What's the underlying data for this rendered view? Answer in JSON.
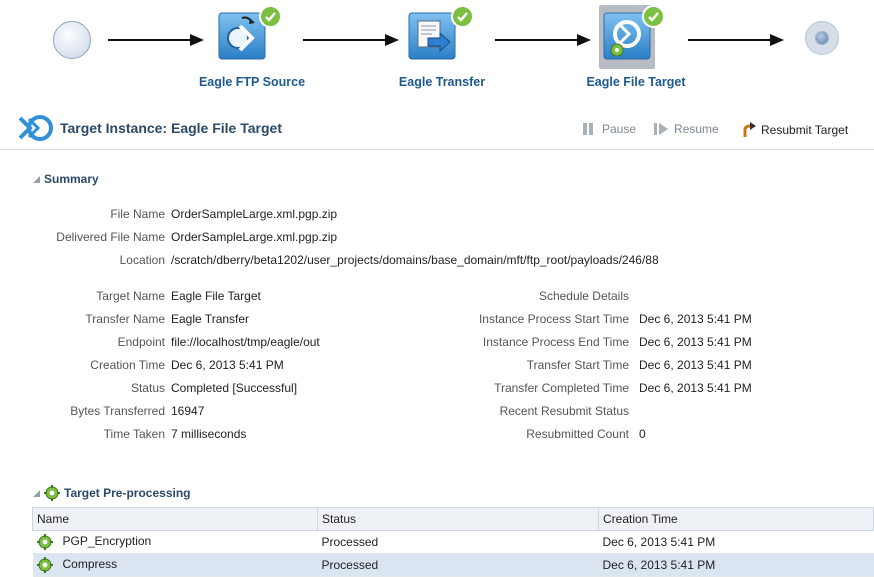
{
  "flow": {
    "nodes": [
      {
        "label": "Eagle FTP Source",
        "icon": "ftp-source-icon",
        "status": "completed"
      },
      {
        "label": "Eagle Transfer",
        "icon": "transfer-icon",
        "status": "completed"
      },
      {
        "label": "Eagle File Target",
        "icon": "file-target-icon",
        "status": "completed",
        "selected": true
      }
    ]
  },
  "header": {
    "title": "Target Instance: Eagle File Target",
    "actions": [
      {
        "label": "Pause",
        "icon": "pause-icon",
        "enabled": false
      },
      {
        "label": "Resume",
        "icon": "resume-icon",
        "enabled": false
      },
      {
        "label": "Resubmit Target",
        "icon": "resubmit-icon",
        "enabled": true
      }
    ]
  },
  "summary": {
    "title": "Summary",
    "file_name": {
      "label": "File Name",
      "value": "OrderSampleLarge.xml.pgp.zip"
    },
    "delivered_file_name": {
      "label": "Delivered File Name",
      "value": "OrderSampleLarge.xml.pgp.zip"
    },
    "location": {
      "label": "Location",
      "value": "/scratch/dberry/beta1202/user_projects/domains/base_domain/mft/ftp_root/payloads/246/88"
    },
    "left": [
      {
        "label": "Target Name",
        "value": "Eagle File Target"
      },
      {
        "label": "Transfer Name",
        "value": "Eagle Transfer"
      },
      {
        "label": "Endpoint",
        "value": "file://localhost/tmp/eagle/out"
      },
      {
        "label": "Creation Time",
        "value": "Dec 6, 2013 5:41 PM"
      },
      {
        "label": "Status",
        "value": "Completed [Successful]"
      },
      {
        "label": "Bytes Transferred",
        "value": "16947"
      },
      {
        "label": "Time Taken",
        "value": "7 milliseconds"
      }
    ],
    "right": [
      {
        "label": "Schedule Details",
        "value": ""
      },
      {
        "label": "Instance Process Start Time",
        "value": "Dec 6, 2013 5:41 PM"
      },
      {
        "label": "Instance Process End Time",
        "value": "Dec 6, 2013 5:41 PM"
      },
      {
        "label": "Transfer Start Time",
        "value": "Dec 6, 2013 5:41 PM"
      },
      {
        "label": "Transfer Completed Time",
        "value": "Dec 6, 2013 5:41 PM"
      },
      {
        "label": "Recent Resubmit Status",
        "value": ""
      },
      {
        "label": "Resubmitted Count",
        "value": "0"
      }
    ]
  },
  "preprocessing": {
    "title": "Target Pre-processing",
    "columns": [
      "Name",
      "Status",
      "Creation Time"
    ],
    "rows": [
      {
        "name": "PGP_Encryption",
        "status": "Processed",
        "time": "Dec 6, 2013 5:41 PM"
      },
      {
        "name": "Compress",
        "status": "Processed",
        "time": "Dec 6, 2013 5:41 PM"
      }
    ]
  },
  "colors": {
    "accent": "#1d5a8f",
    "check": "#7bc043",
    "header_text": "#2c4969"
  }
}
